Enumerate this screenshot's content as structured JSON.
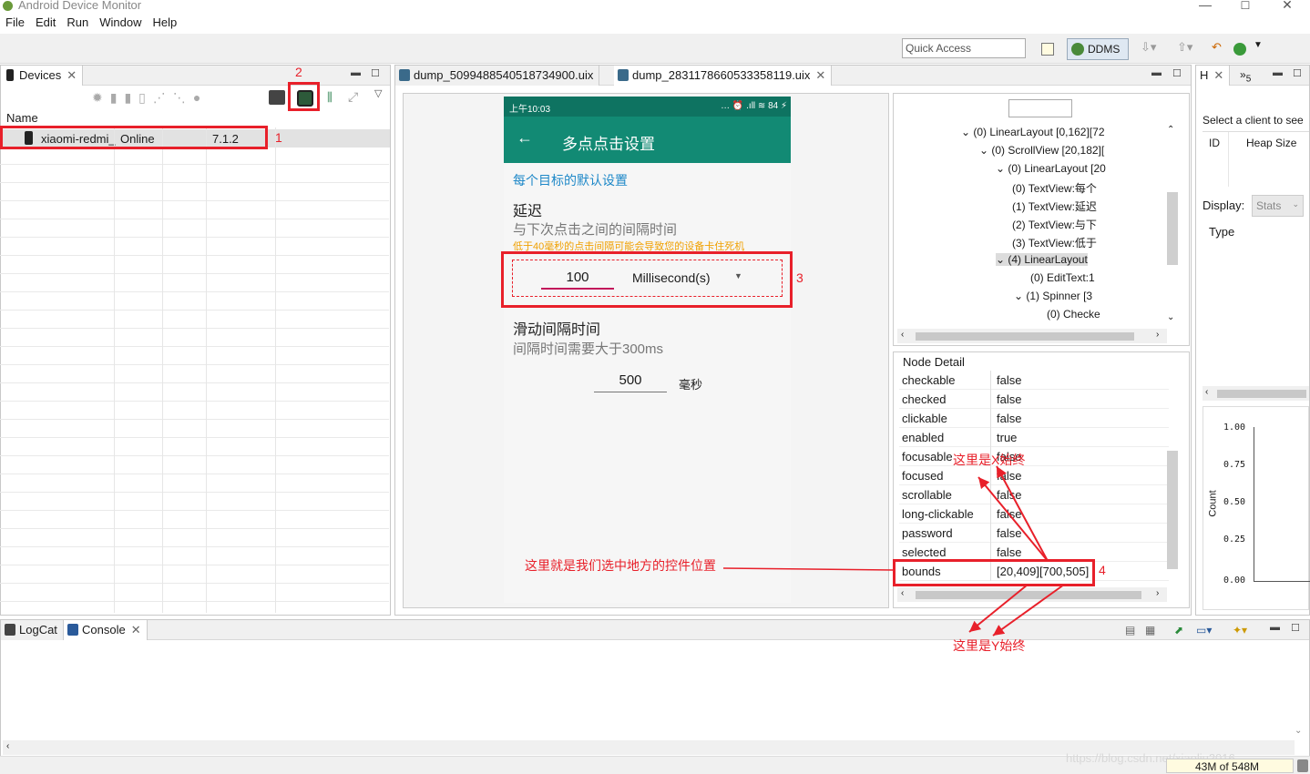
{
  "window": {
    "title": "Android Device Monitor",
    "min": "—",
    "max": "☐",
    "close": "✕"
  },
  "menu": [
    "File",
    "Edit",
    "Run",
    "Window",
    "Help"
  ],
  "toolbar": {
    "quick_access_placeholder": "Quick Access",
    "perspective_label": "DDMS"
  },
  "devices_panel": {
    "tab_label": "Devices",
    "column_header": "Name",
    "device": {
      "name": "xiaomi-redmi_",
      "status": "Online",
      "version": "7.1.2"
    }
  },
  "dump_tabs": [
    {
      "label": "dump_5099488540518734900.uix"
    },
    {
      "label": "dump_2831178660533358119.uix"
    }
  ],
  "phone": {
    "status_time": "上午10:03",
    "status_right": "… ⏰ .ıll ≋ 84 ⚡",
    "title": "多点点击设置",
    "section_link": "每个目标的默认设置",
    "delay_title": "延迟",
    "delay_sub": "与下次点击之间的间隔时间",
    "warning": "低于40毫秒的点击间隔可能会导致您的设备卡住死机",
    "delay_value": "100",
    "delay_unit": "Millisecond(s)",
    "swipe_title": "滑动间隔时间",
    "swipe_sub": "间隔时间需要大于300ms",
    "swipe_value": "500",
    "swipe_unit": "毫秒"
  },
  "hierarchy": {
    "nodes": [
      {
        "text": "(0) LinearLayout [0,162][72",
        "expander": "⌄"
      },
      {
        "text": "(0) ScrollView [20,182][",
        "expander": "⌄"
      },
      {
        "text": "(0) LinearLayout [20",
        "expander": "⌄"
      },
      {
        "text": "(0) TextView:每个",
        "expander": ""
      },
      {
        "text": "(1) TextView:延迟",
        "expander": ""
      },
      {
        "text": "(2) TextView:与下",
        "expander": ""
      },
      {
        "text": "(3) TextView:低于",
        "expander": ""
      },
      {
        "text": "(4) LinearLayout",
        "expander": "⌄"
      },
      {
        "text": "(0) EditText:1",
        "expander": ""
      },
      {
        "text": "(1) Spinner [3",
        "expander": "⌄"
      },
      {
        "text": "(0) Checke",
        "expander": ""
      }
    ]
  },
  "node_detail": {
    "title": "Node Detail",
    "rows": [
      {
        "k": "checkable",
        "v": "false"
      },
      {
        "k": "checked",
        "v": "false"
      },
      {
        "k": "clickable",
        "v": "false"
      },
      {
        "k": "enabled",
        "v": "true"
      },
      {
        "k": "focusable",
        "v": "false"
      },
      {
        "k": "focused",
        "v": "false"
      },
      {
        "k": "scrollable",
        "v": "false"
      },
      {
        "k": "long-clickable",
        "v": "false"
      },
      {
        "k": "password",
        "v": "false"
      },
      {
        "k": "selected",
        "v": "false"
      },
      {
        "k": "bounds",
        "v": "[20,409][700,505]"
      }
    ]
  },
  "heap_panel": {
    "tab_label": "H",
    "tab2_label": "»",
    "tab2_count": "5",
    "hint": "Select a client to see",
    "col_id": "ID",
    "col_heap": "Heap Size",
    "display_label": "Display:",
    "display_value": "Stats",
    "type_label": "Type",
    "chart_ylabel": "Count",
    "chart_ticks": [
      "1.00",
      "0.75",
      "0.50",
      "0.25",
      "0.00"
    ]
  },
  "bottom_tabs": {
    "logcat": "LogCat",
    "console": "Console"
  },
  "status": {
    "memory": "43M of 548M",
    "watermark": "https://blog.csdn.net/xiaoliu2016"
  },
  "annotations": {
    "n1": "1",
    "n2": "2",
    "n3": "3",
    "n4": "4",
    "x_const": "这里是X始终",
    "y_const": "这里是Y始终",
    "position_note": "这里就是我们选中地方的控件位置"
  }
}
